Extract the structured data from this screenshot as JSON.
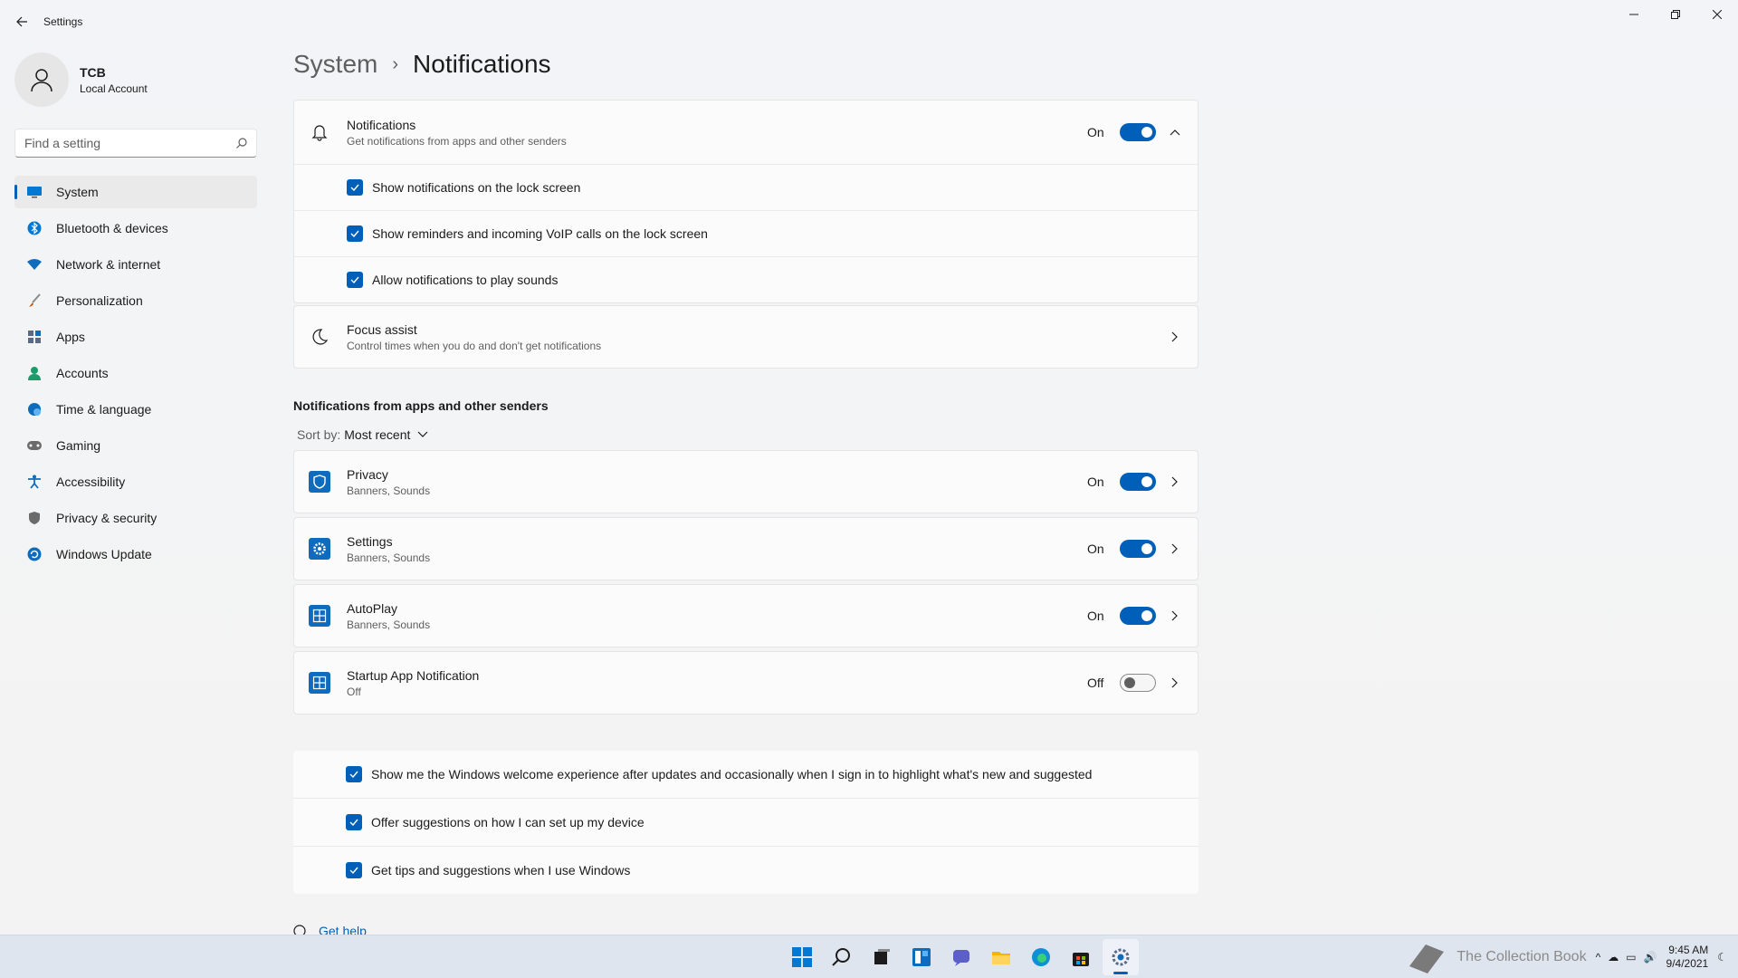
{
  "window": {
    "title": "Settings"
  },
  "profile": {
    "name": "TCB",
    "account": "Local Account"
  },
  "search": {
    "placeholder": "Find a setting"
  },
  "sidebar": {
    "items": [
      {
        "label": "System",
        "icon": "monitor-icon",
        "color": "#0078d4"
      },
      {
        "label": "Bluetooth & devices",
        "icon": "bluetooth-icon",
        "color": "#0078d4"
      },
      {
        "label": "Network & internet",
        "icon": "wifi-icon",
        "color": "#0f6cbd"
      },
      {
        "label": "Personalization",
        "icon": "brush-icon",
        "color": "#c15b18"
      },
      {
        "label": "Apps",
        "icon": "apps-icon",
        "color": "#5a6a86"
      },
      {
        "label": "Accounts",
        "icon": "person-icon",
        "color": "#1a9c6c"
      },
      {
        "label": "Time & language",
        "icon": "globe-clock-icon",
        "color": "#0f6cbd"
      },
      {
        "label": "Gaming",
        "icon": "controller-icon",
        "color": "#6b6b6b"
      },
      {
        "label": "Accessibility",
        "icon": "accessibility-icon",
        "color": "#0f6cbd"
      },
      {
        "label": "Privacy & security",
        "icon": "shield-icon",
        "color": "#6b6b6b"
      },
      {
        "label": "Windows Update",
        "icon": "update-icon",
        "color": "#0f6cbd"
      }
    ]
  },
  "breadcrumb": {
    "parent": "System",
    "current": "Notifications"
  },
  "notifications": {
    "title": "Notifications",
    "subtitle": "Get notifications from apps and other senders",
    "state": "On",
    "options": [
      "Show notifications on the lock screen",
      "Show reminders and incoming VoIP calls on the lock screen",
      "Allow notifications to play sounds"
    ]
  },
  "focus_assist": {
    "title": "Focus assist",
    "subtitle": "Control times when you do and don't get notifications"
  },
  "senders": {
    "section_title": "Notifications from apps and other senders",
    "sort_label": "Sort by:",
    "sort_value": "Most recent",
    "apps": [
      {
        "name": "Privacy",
        "detail": "Banners, Sounds",
        "state": "On",
        "on": true,
        "icon": "shield-icon"
      },
      {
        "name": "Settings",
        "detail": "Banners, Sounds",
        "state": "On",
        "on": true,
        "icon": "gear-icon"
      },
      {
        "name": "AutoPlay",
        "detail": "Banners, Sounds",
        "state": "On",
        "on": true,
        "icon": "autoplay-icon"
      },
      {
        "name": "Startup App Notification",
        "detail": "Off",
        "state": "Off",
        "on": false,
        "icon": "startup-icon"
      }
    ]
  },
  "bottom_options": [
    "Show me the Windows welcome experience after updates and occasionally when I sign in to highlight what's new and suggested",
    "Offer suggestions on how I can set up my device",
    "Get tips and suggestions when I use Windows"
  ],
  "help": {
    "label": "Get help"
  },
  "taskbar": {
    "icons": [
      "windows-start-icon",
      "search-icon",
      "task-view-icon",
      "widgets-icon",
      "chat-icon",
      "file-explorer-icon",
      "edge-icon",
      "store-icon",
      "settings-icon"
    ],
    "watermark": "The Collection Book",
    "time": "9:45 AM",
    "date": "9/4/2021"
  },
  "colors": {
    "accent": "#005fb8"
  }
}
